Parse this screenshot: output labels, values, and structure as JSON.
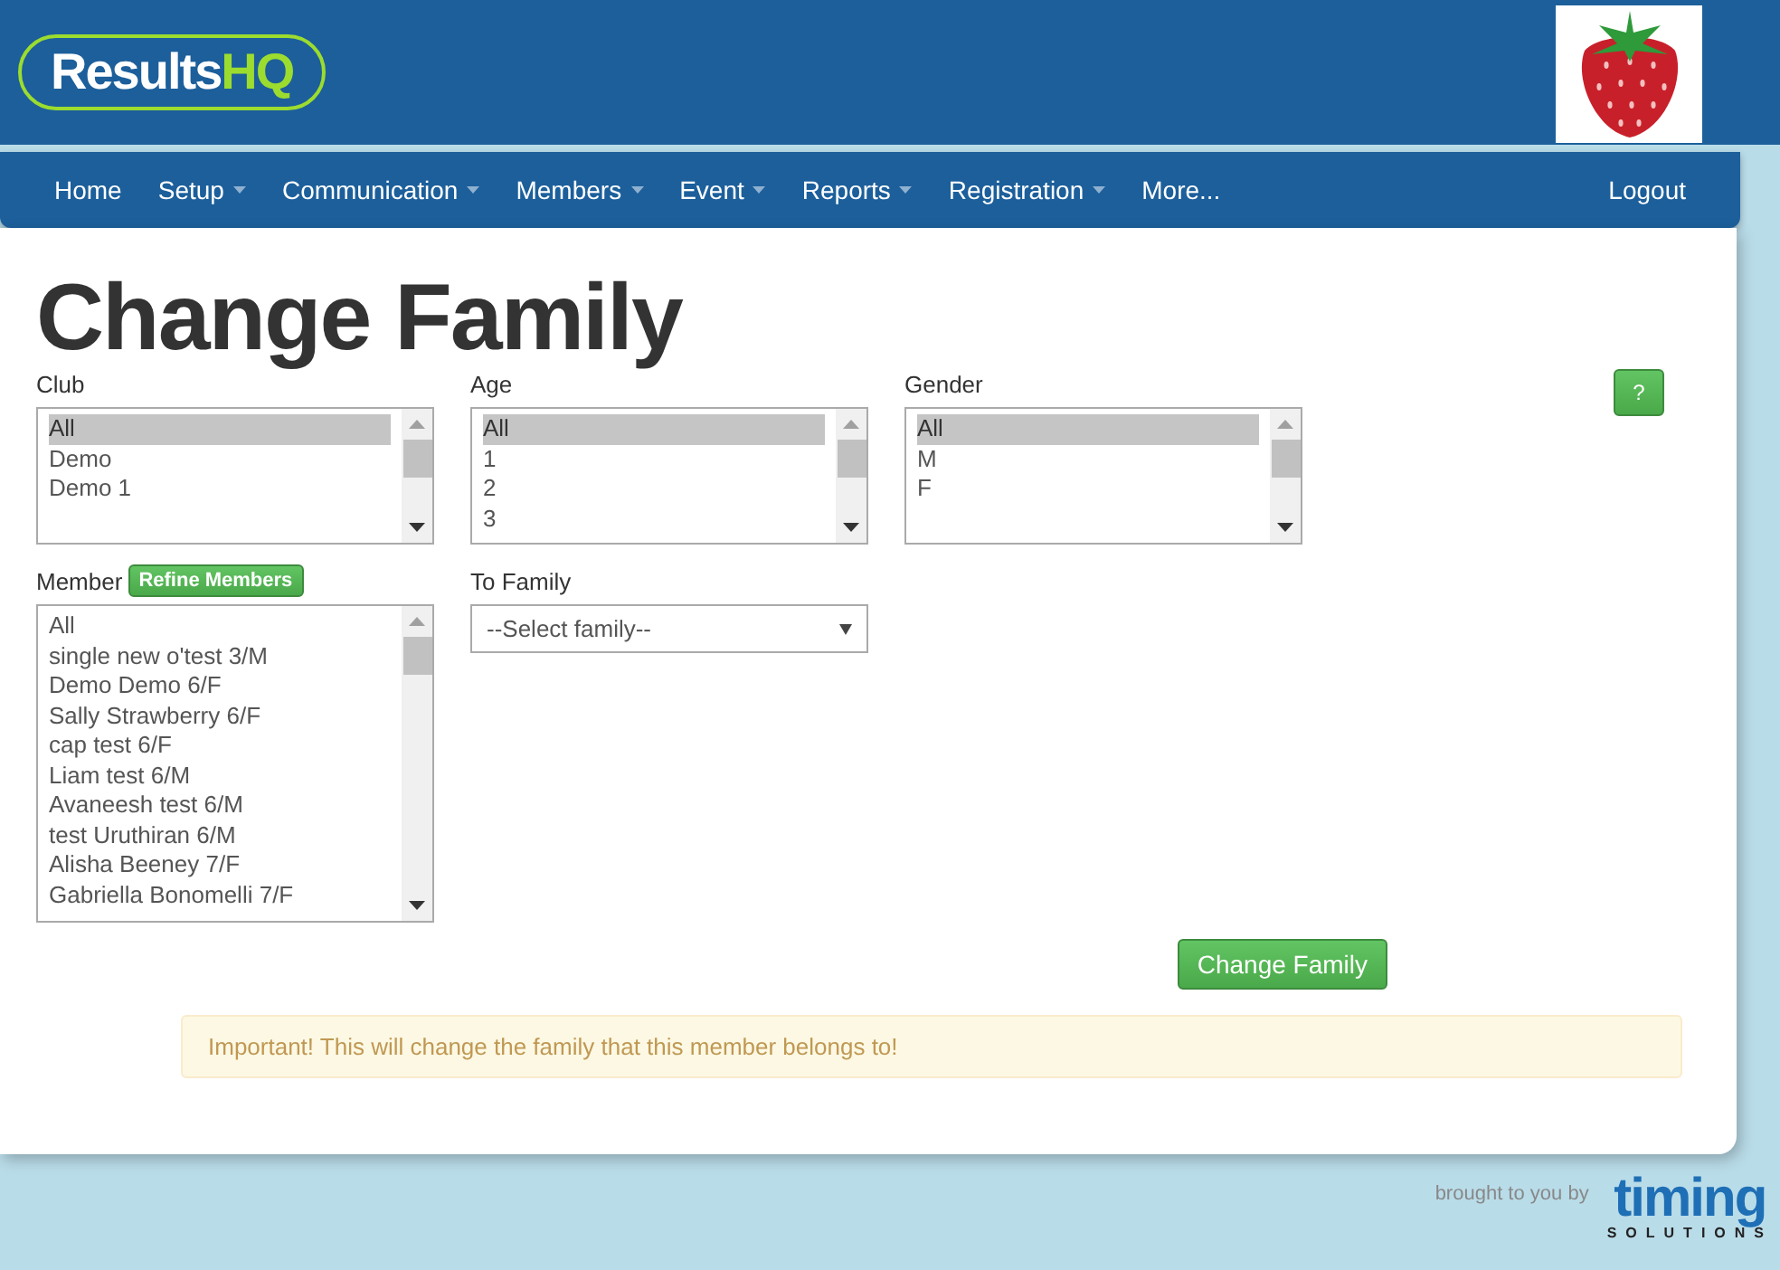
{
  "header": {
    "logo": {
      "text": "Results",
      "accent": "HQ"
    }
  },
  "nav": {
    "items": [
      {
        "label": "Home",
        "dropdown": false
      },
      {
        "label": "Setup",
        "dropdown": true
      },
      {
        "label": "Communication",
        "dropdown": true
      },
      {
        "label": "Members",
        "dropdown": true
      },
      {
        "label": "Event",
        "dropdown": true
      },
      {
        "label": "Reports",
        "dropdown": true
      },
      {
        "label": "Registration",
        "dropdown": true
      },
      {
        "label": "More...",
        "dropdown": false
      }
    ],
    "logout": "Logout"
  },
  "page": {
    "title": "Change Family",
    "help_button": "?",
    "filters": [
      {
        "label": "Club",
        "options": [
          {
            "label": "All",
            "selected": true
          },
          {
            "label": "Demo",
            "selected": false
          },
          {
            "label": "Demo 1",
            "selected": false
          }
        ]
      },
      {
        "label": "Age",
        "options": [
          {
            "label": "All",
            "selected": true
          },
          {
            "label": "1",
            "selected": false
          },
          {
            "label": "2",
            "selected": false
          },
          {
            "label": "3",
            "selected": false
          }
        ]
      },
      {
        "label": "Gender",
        "options": [
          {
            "label": "All",
            "selected": true
          },
          {
            "label": "M",
            "selected": false
          },
          {
            "label": "F",
            "selected": false
          }
        ]
      }
    ],
    "member": {
      "label": "Member",
      "refine_button": "Refine Members",
      "options": [
        {
          "label": "All",
          "selected": false
        },
        {
          "label": "single new o'test 3/M",
          "selected": false
        },
        {
          "label": "Demo Demo 6/F",
          "selected": false
        },
        {
          "label": "Sally Strawberry 6/F",
          "selected": false
        },
        {
          "label": "cap test 6/F",
          "selected": false
        },
        {
          "label": "Liam test 6/M",
          "selected": false
        },
        {
          "label": "Avaneesh test 6/M",
          "selected": false
        },
        {
          "label": "test Uruthiran 6/M",
          "selected": false
        },
        {
          "label": "Alisha Beeney 7/F",
          "selected": false
        },
        {
          "label": "Gabriella Bonomelli 7/F",
          "selected": false
        }
      ]
    },
    "to_family": {
      "label": "To Family",
      "value": "--Select family--"
    },
    "submit_button": "Change Family",
    "alert": "Important! This will change the family that this member belongs to!"
  },
  "footer": {
    "credit": "brought to you by",
    "logo": {
      "text": "timing",
      "subtext": "SOLUTIONS"
    }
  }
}
